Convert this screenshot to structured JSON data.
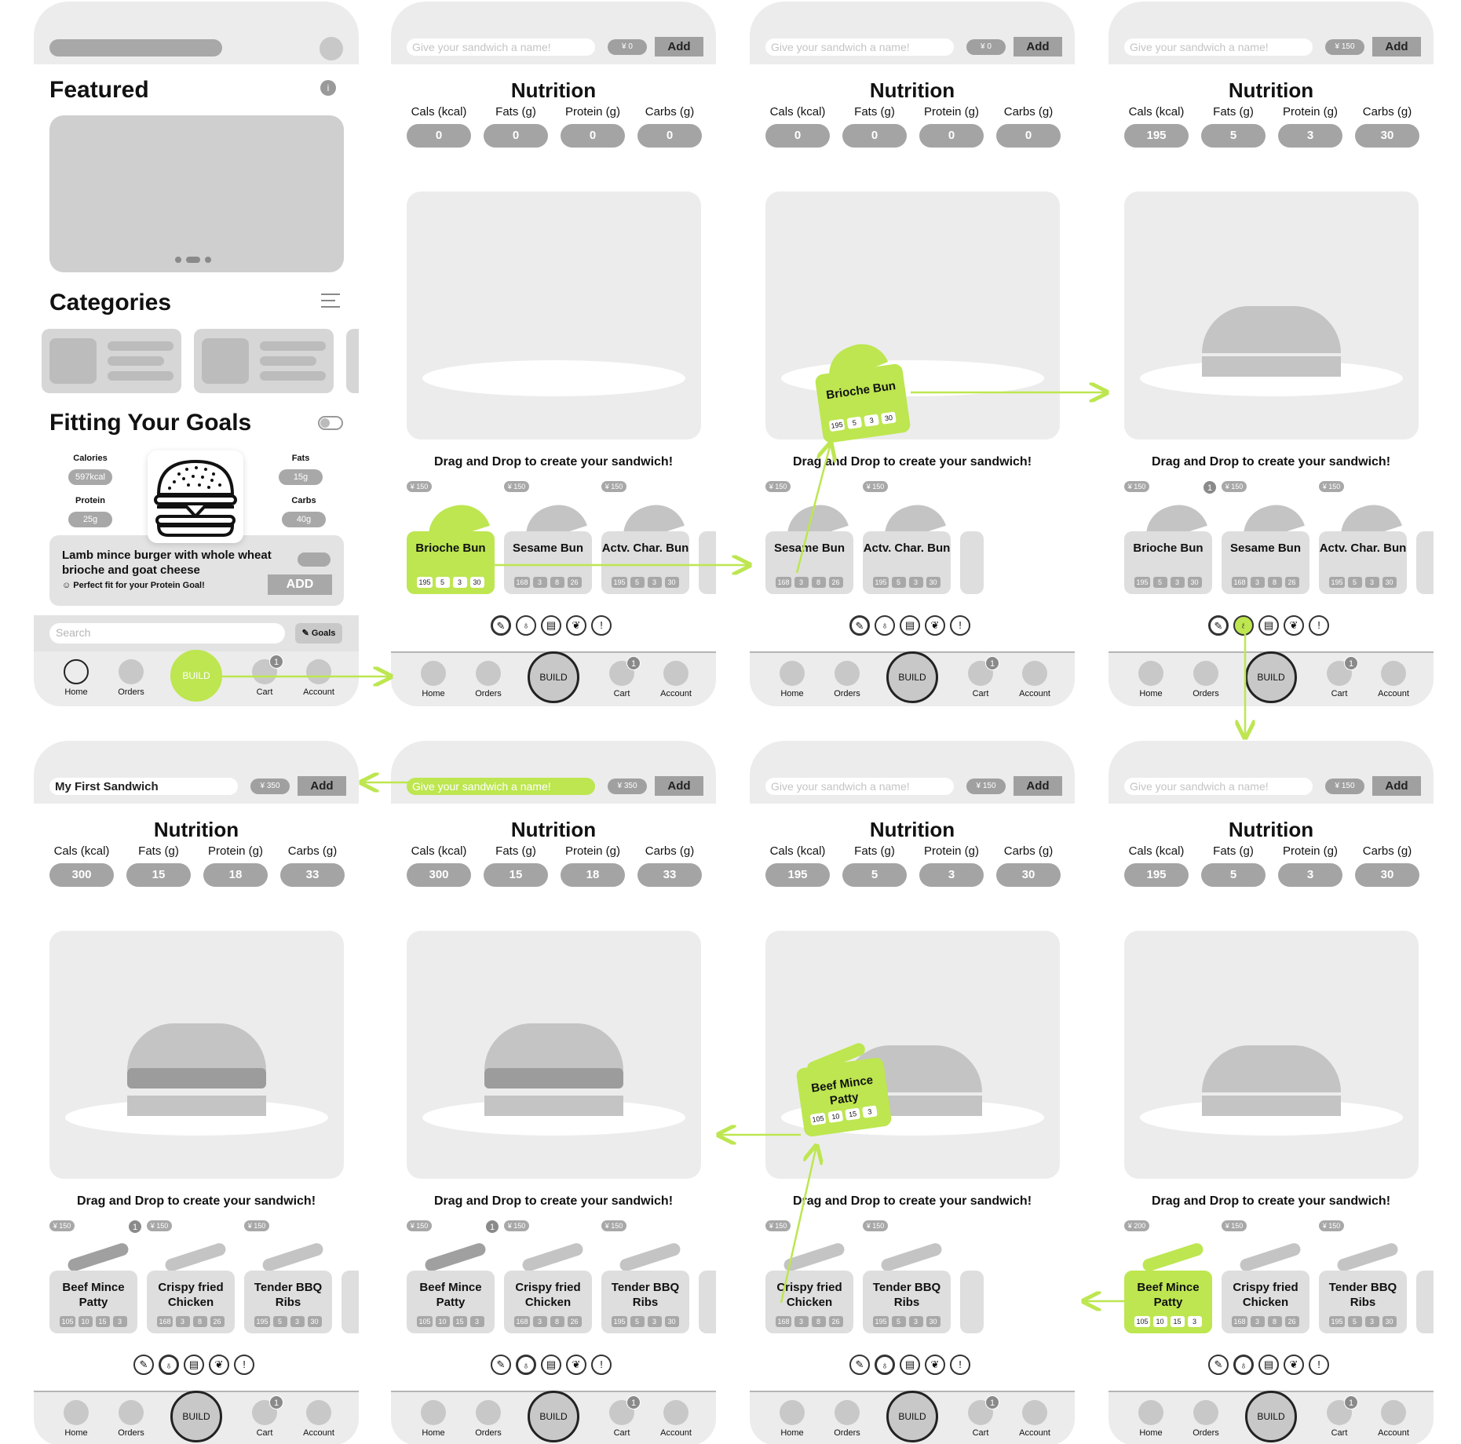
{
  "home": {
    "featured_title": "Featured",
    "info_icon": "i",
    "categories_title": "Categories",
    "goals_title": "Fitting Your Goals",
    "goals": [
      {
        "label": "Calories",
        "value": "597kcal"
      },
      {
        "label": "Fats",
        "value": "15g"
      },
      {
        "label": "Protein",
        "value": "25g"
      },
      {
        "label": "Carbs",
        "value": "40g"
      }
    ],
    "goal_card_text": "Lamb mince burger with whole wheat brioche and goat cheese",
    "goal_card_sub": "Perfect fit for your Protein Goal!",
    "goal_card_add": "ADD",
    "search_placeholder": "Search",
    "goals_button": "Goals",
    "build_label": "BUILD"
  },
  "nav": {
    "home": "Home",
    "orders": "Orders",
    "build": "BUILD",
    "cart": "Cart",
    "account": "Account",
    "cart_count": "1"
  },
  "builder": {
    "name_placeholder": "Give your sandwich a name!",
    "add_label": "Add",
    "nutrition_title": "Nutrition",
    "labels": [
      "Cals (kcal)",
      "Fats (g)",
      "Protein (g)",
      "Carbs (g)"
    ],
    "drag_label": "Drag and Drop to create your sandwich!"
  },
  "screens": [
    {
      "price": "¥ 0",
      "values": [
        "0",
        "0",
        "0",
        "0"
      ]
    },
    {
      "price": "¥ 0",
      "values": [
        "0",
        "0",
        "0",
        "0"
      ]
    },
    {
      "price": "¥ 150",
      "values": [
        "195",
        "5",
        "3",
        "30"
      ]
    },
    {
      "name": "My First Sandwich",
      "price": "¥ 350",
      "values": [
        "300",
        "15",
        "18",
        "33"
      ]
    },
    {
      "price": "¥ 350",
      "values": [
        "300",
        "15",
        "18",
        "33"
      ]
    },
    {
      "price": "¥ 150",
      "values": [
        "195",
        "5",
        "3",
        "30"
      ]
    },
    {
      "price": "¥ 150",
      "values": [
        "195",
        "5",
        "3",
        "30"
      ]
    }
  ],
  "breads": [
    {
      "name": "Brioche Bun",
      "price": "¥ 150",
      "macros": [
        "195",
        "5",
        "3",
        "30"
      ]
    },
    {
      "name": "Sesame Bun",
      "price": "¥ 150",
      "macros": [
        "168",
        "3",
        "8",
        "26"
      ]
    },
    {
      "name": "Actv. Char. Bun",
      "price": "¥ 150",
      "macros": [
        "195",
        "5",
        "3",
        "30"
      ]
    }
  ],
  "proteins": [
    {
      "name": "Beef Mince Patty",
      "price": "¥ 150",
      "price_alt": "¥ 200",
      "macros": [
        "105",
        "10",
        "15",
        "3"
      ]
    },
    {
      "name": "Crispy fried Chicken",
      "price": "¥ 150",
      "macros": [
        "168",
        "3",
        "8",
        "26"
      ]
    },
    {
      "name": "Tender BBQ Ribs",
      "price": "¥ 150",
      "macros": [
        "195",
        "5",
        "3",
        "30"
      ]
    }
  ],
  "badge": "1",
  "accent": "#bde650"
}
